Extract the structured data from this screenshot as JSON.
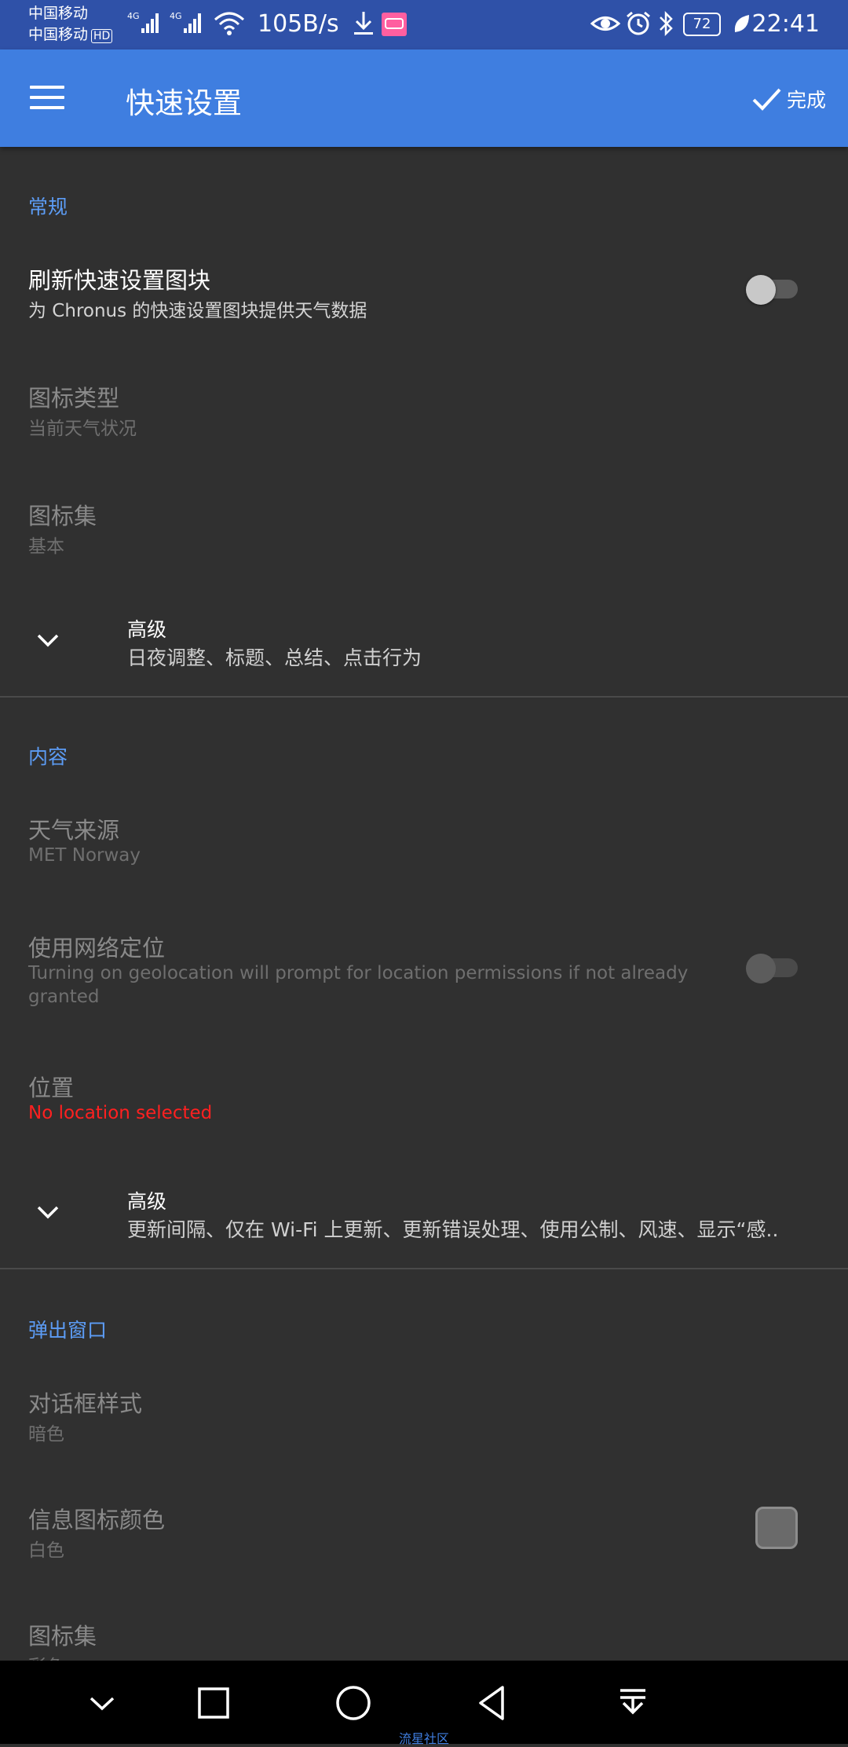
{
  "status_bar": {
    "carrier1": "中国移动",
    "carrier2": "中国移动",
    "hd": "HD",
    "net1": "4G",
    "net2": "4G",
    "speed": "105B/s",
    "battery": "72",
    "time": "22:41"
  },
  "app_bar": {
    "title": "快速设置",
    "done_label": "完成"
  },
  "sections": {
    "general": {
      "header": "常规",
      "refresh_tile": {
        "title": "刷新快速设置图块",
        "summary": "为 Chronus 的快速设置图块提供天气数据",
        "enabled": false
      },
      "icon_type": {
        "title": "图标类型",
        "summary": "当前天气状况"
      },
      "icon_set": {
        "title": "图标集",
        "summary": "基本"
      },
      "advanced": {
        "title": "高级",
        "summary": "日夜调整、标题、总结、点击行为"
      }
    },
    "content": {
      "header": "内容",
      "weather_source": {
        "title": "天气来源",
        "summary": "MET Norway"
      },
      "network_location": {
        "title": "使用网络定位",
        "summary_line1": "Turning on geolocation will prompt for location permissions if not already",
        "summary_line2": "granted",
        "enabled": false
      },
      "location": {
        "title": "位置",
        "summary": "No location selected"
      },
      "advanced": {
        "title": "高级",
        "summary": "更新间隔、仅在 Wi-Fi 上更新、更新错误处理、使用公制、风速、显示“感.."
      }
    },
    "popup": {
      "header": "弹出窗口",
      "dialog_style": {
        "title": "对话框样式",
        "summary": "暗色"
      },
      "info_icon_color": {
        "title": "信息图标颜色",
        "summary": "白色"
      },
      "icon_set": {
        "title": "图标集",
        "summary": "彩色"
      }
    }
  },
  "watermark": "流星社区",
  "colors": {
    "accent": "#3f7ee0",
    "section_header": "#5c9cf5",
    "error": "#ff2020",
    "background": "#303030"
  }
}
